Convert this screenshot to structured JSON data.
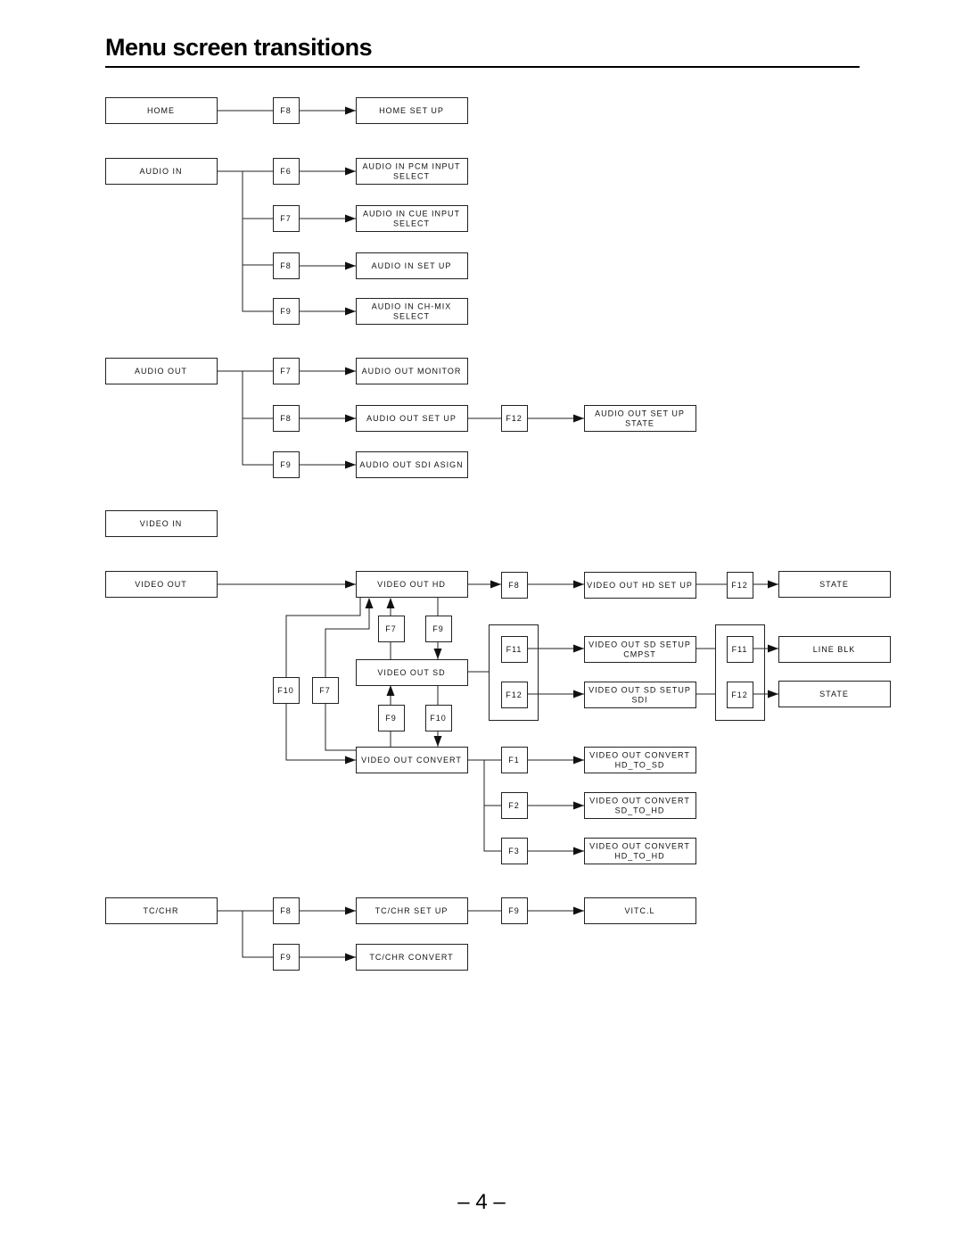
{
  "page": {
    "title": "Menu screen transitions",
    "page_number": "– 4 –"
  },
  "nodes": {
    "home": "HOME",
    "home_setup": "HOME SET UP",
    "audio_in": "AUDIO IN",
    "audio_in_pcm": [
      "AUDIO IN PCM INPUT",
      "SELECT"
    ],
    "audio_in_cue": [
      "AUDIO IN CUE INPUT",
      "SELECT"
    ],
    "audio_in_setup": "AUDIO IN SET UP",
    "audio_in_chmix": [
      "AUDIO IN CH-MIX",
      "SELECT"
    ],
    "audio_out": "AUDIO OUT",
    "audio_out_monitor": "AUDIO OUT MONITOR",
    "audio_out_setup": "AUDIO OUT  SET UP",
    "audio_out_setup_state": [
      "AUDIO OUT  SET UP",
      "STATE"
    ],
    "audio_out_sdi": "AUDIO OUT  SDI ASIGN",
    "video_in": "VIDEO IN",
    "video_out": "VIDEO OUT",
    "video_out_hd": "VIDEO OUT HD",
    "video_out_hd_setup": "VIDEO OUT HD SET UP",
    "hd_state": "STATE",
    "video_out_sd": "VIDEO OUT SD",
    "sd_setup_cmpst": [
      "VIDEO OUT SD SETUP",
      "CMPST"
    ],
    "sd_setup_sdi": [
      "VIDEO OUT SD SETUP",
      "SDI"
    ],
    "line_blk": "LINE BLK",
    "sd_state": "STATE",
    "video_out_convert": "VIDEO OUT CONVERT",
    "conv_hd_to_sd": [
      "VIDEO OUT CONVERT",
      "HD_TO_SD"
    ],
    "conv_sd_to_hd": [
      "VIDEO OUT CONVERT",
      "SD_TO_HD"
    ],
    "conv_hd_to_hd": [
      "VIDEO OUT CONVERT",
      "HD_TO_HD"
    ],
    "tc_chr": "TC/CHR",
    "tc_chr_setup": "TC/CHR SET UP",
    "vitc_l": "VITC.L",
    "tc_chr_convert": "TC/CHR CONVERT"
  },
  "keys": {
    "home_f8": "F8",
    "ain_f6": "F6",
    "ain_f7": "F7",
    "ain_f8": "F8",
    "ain_f9": "F9",
    "aout_f7": "F7",
    "aout_f8": "F8",
    "aout_f9": "F9",
    "aout_setup_f12": "F12",
    "vout_hd_f8": "F8",
    "hd_setup_f12": "F12",
    "hd_to_sd_f9": "F9",
    "sd_to_hd_f7": "F7",
    "conv_to_sd_f9": "F9",
    "sd_to_conv_f10": "F10",
    "conv_to_hd_f10": "F10",
    "conv_to_hd_f7": "F7",
    "sd_f11": "F11",
    "sd_f12": "F12",
    "sd_setup_f11": "F11",
    "sd_setup_f12": "F12",
    "conv_f1": "F1",
    "conv_f2": "F2",
    "conv_f3": "F3",
    "tc_f8": "F8",
    "tc_f9": "F9",
    "tc_setup_f9": "F9"
  }
}
